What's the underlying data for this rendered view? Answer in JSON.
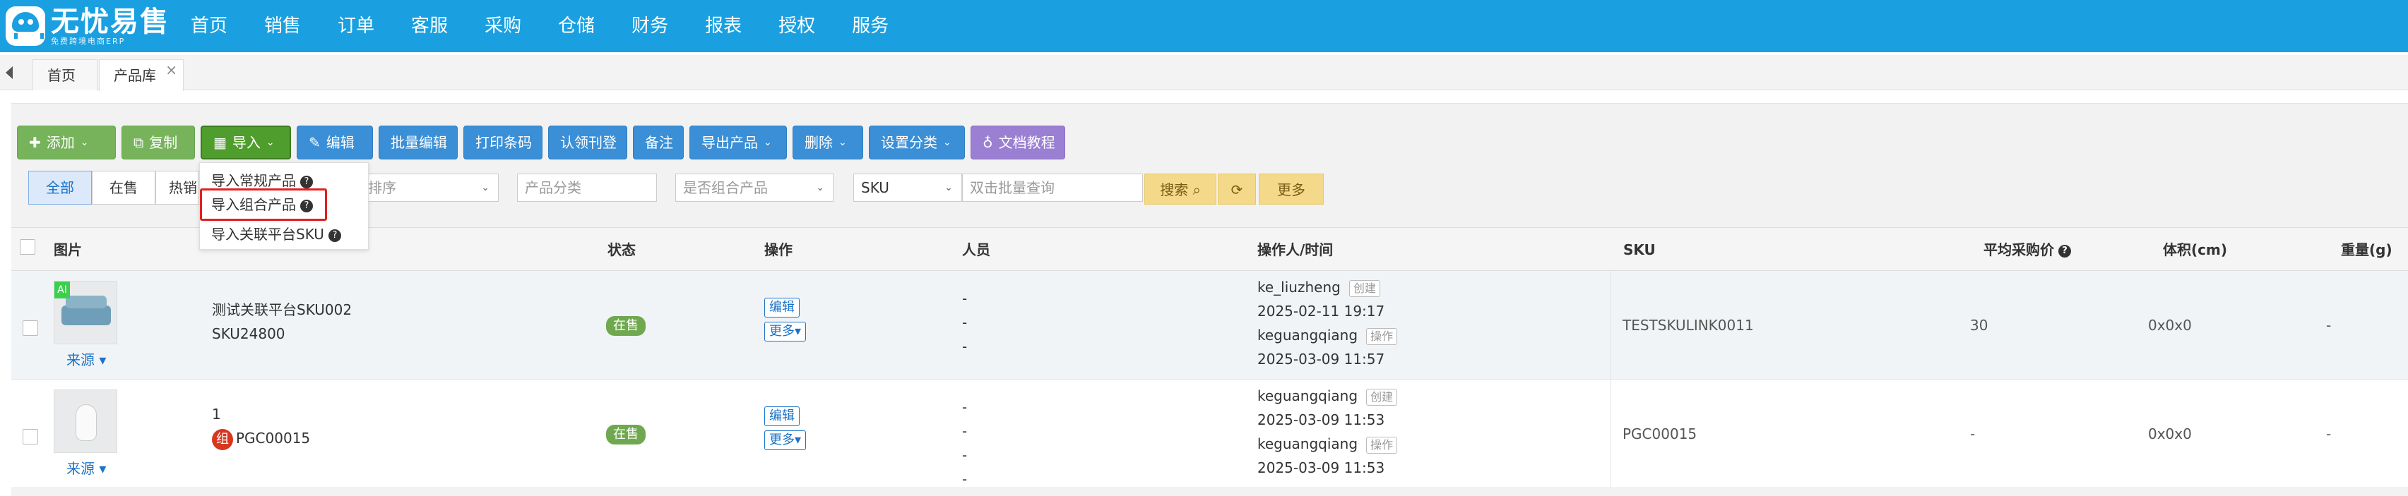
{
  "app": {
    "logo_title": "无忧易售",
    "logo_sub": "免费跨境电商ERP"
  },
  "nav": [
    "首页",
    "销售",
    "订单",
    "客服",
    "采购",
    "仓储",
    "财务",
    "报表",
    "授权",
    "服务"
  ],
  "tabs": {
    "home": "首页",
    "active": "产品库",
    "close": "×"
  },
  "toolbar": {
    "add": "添加",
    "copy": "复制",
    "import": "导入",
    "edit": "编辑",
    "batch_edit": "批量编辑",
    "print_barcode": "打印条码",
    "claim_register": "认领刊登",
    "note": "备注",
    "export": "导出产品",
    "delete": "删除",
    "set_category": "设置分类",
    "doc_tutorial": "文档教程"
  },
  "import_menu": {
    "regular": "导入常规产品",
    "combo": "导入组合产品",
    "linked_sku": "导入关联平台SKU"
  },
  "filters": {
    "tabs": [
      "全部",
      "在售",
      "热销"
    ],
    "sort_placeholder": "排序",
    "category_placeholder": "产品分类",
    "combo_placeholder": "是否组合产品",
    "sku_select": "SKU",
    "batch_query_placeholder": "双击批量查询",
    "search": "搜索",
    "more": "更多"
  },
  "table": {
    "headers": [
      "图片",
      "状态",
      "操作",
      "人员",
      "操作人/时间",
      "SKU",
      "平均采购价",
      "体积(cm)",
      "重量(g)"
    ],
    "rows": [
      {
        "ai_badge": "AI",
        "source": "来源",
        "name": "测试关联平台SKU002",
        "code": "SKU24800",
        "status": "在售",
        "edit": "编辑",
        "more": "更多",
        "persons": [
          "-",
          "-",
          "-"
        ],
        "op1_user": "ke_liuzheng",
        "op1_tag": "创建",
        "op1_time": "2025-02-11 19:17",
        "op2_user": "keguangqiang",
        "op2_tag": "操作",
        "op2_time": "2025-03-09 11:57",
        "sku": "TESTSKULINK0011",
        "avg_price": "30",
        "volume": "0x0x0",
        "weight": "-"
      },
      {
        "source": "来源",
        "name": "1",
        "combo_badge": "组",
        "code": "PGC00015",
        "status": "在售",
        "edit": "编辑",
        "more": "更多",
        "persons": [
          "-",
          "-",
          "-",
          "-"
        ],
        "op1_user": "keguangqiang",
        "op1_tag": "创建",
        "op1_time": "2025-03-09 11:53",
        "op2_user": "keguangqiang",
        "op2_tag": "操作",
        "op2_time": "2025-03-09 11:53",
        "sku": "PGC00015",
        "avg_price": "-",
        "volume": "0x0x0",
        "weight": "-"
      }
    ]
  },
  "colors": {
    "topbar": "#1aa0e0",
    "btn_green": "#76b35b",
    "btn_blue": "#3a8fd6",
    "btn_purple": "#9b7fd2",
    "search_yellow": "#f5d98a",
    "highlight_red": "#e0201f"
  }
}
